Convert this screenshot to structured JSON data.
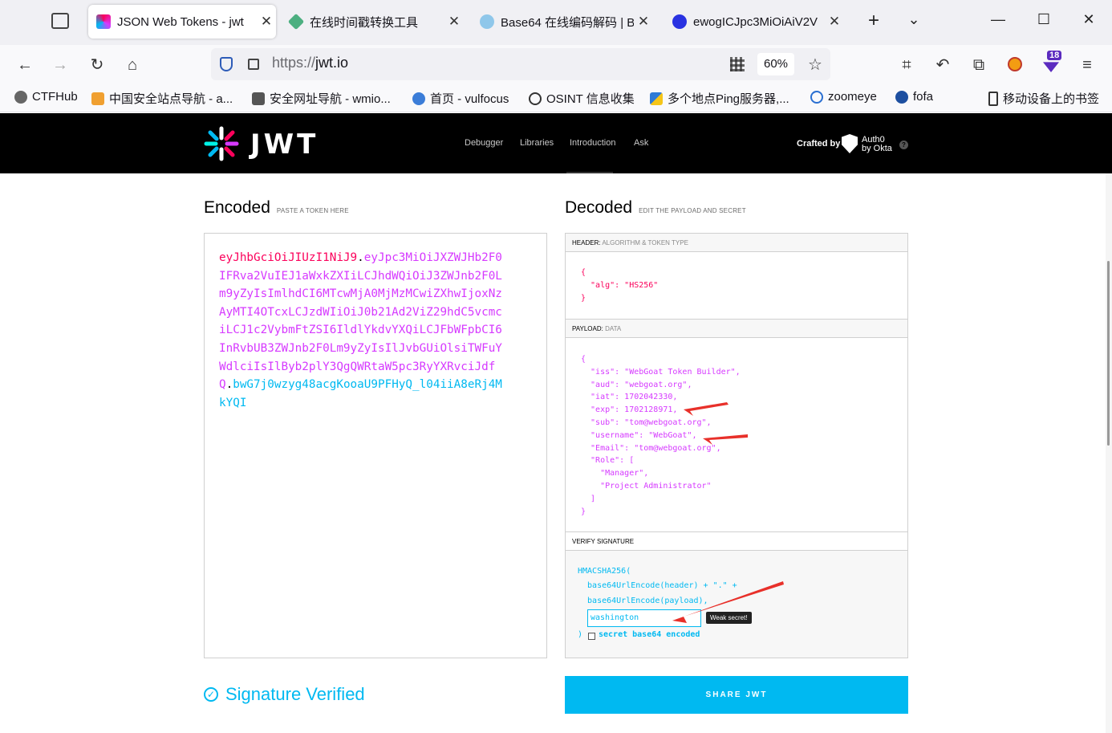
{
  "browser": {
    "tabs": [
      {
        "title": "JSON Web Tokens - jwt",
        "icon": "jwt-icon",
        "active": true
      },
      {
        "title": "在线时间戳转换工具",
        "icon": "timestamp-tool-icon",
        "active": false
      },
      {
        "title": "Base64 在线编码解码 | B",
        "icon": "base64-tool-icon",
        "active": false
      },
      {
        "title": "ewogICJpc3MiOiAiV2V",
        "icon": "baidu-paw-icon",
        "active": false
      }
    ],
    "url_protocol": "https://",
    "url_host": "jwt.io",
    "zoom": "60%",
    "extension_badge": "18",
    "bookmarks": [
      "CTFHub",
      "中国安全站点导航 - a...",
      "安全网址导航 - wmio...",
      "首页 - vulfocus",
      "OSINT 信息收集",
      "多个地点Ping服务器,...",
      "zoomeye",
      "fofa",
      "移动设备上的书签"
    ]
  },
  "site": {
    "logo_text": "JWT",
    "nav": [
      "Debugger",
      "Libraries",
      "Introduction",
      "Ask"
    ],
    "crafted_by": "Crafted by",
    "auth0_line1": "Auth0",
    "auth0_line2": "by Okta"
  },
  "encoded": {
    "title": "Encoded",
    "subtitle": "PASTE A TOKEN HERE",
    "header_part": "eyJhbGciOiJIUzI1NiJ9",
    "payload_part": "eyJpc3MiOiJXZWJHb2F0IFRva2VuIEJ1aWxkZXIiLCJhdWQiOiJ3ZWJnb2F0Lm9yZyIsImlhdCI6MTcwMjA0MjMzMCwiZXhwIjoxNzAyMTI4OTcxLCJzdWIiOiJ0b21Ad2ViZ29hdC5vcmciLCJ1c2VybmFtZSI6IldlYkdvYXQiLCJFbWFpbCI6InRvbUB3ZWJnb2F0Lm9yZyIsIlJvbGUiOlsiTWFuYWdlciIsIlByb2plY3QgQWRtaW5pc3RyYXRvciJdfQ",
    "signature_part": "bwG7j0wzyg48acgKooaU9PFHyQ_l04iiA8eRj4MkYQI",
    "dot": "."
  },
  "decoded": {
    "title": "Decoded",
    "subtitle": "EDIT THE PAYLOAD AND SECRET",
    "header_label": "HEADER:",
    "header_sub": "ALGORITHM & TOKEN TYPE",
    "header_json": "{\n  \"alg\": \"HS256\"\n}",
    "payload_label": "PAYLOAD:",
    "payload_sub": "DATA",
    "payload_json": "{\n  \"iss\": \"WebGoat Token Builder\",\n  \"aud\": \"webgoat.org\",\n  \"iat\": 1702042330,\n  \"exp\": 1702128971,\n  \"sub\": \"tom@webgoat.org\",\n  \"username\": \"WebGoat\",\n  \"Email\": \"tom@webgoat.org\",\n  \"Role\": [\n    \"Manager\",\n    \"Project Administrator\"\n  ]\n}",
    "verify_label": "VERIFY SIGNATURE",
    "sig_line1": "HMACSHA256(",
    "sig_line2": "  base64UrlEncode(header) + \".\" +",
    "sig_line3": "  base64UrlEncode(payload),",
    "secret_value": "washington",
    "weak_badge": "Weak secret!",
    "close_paren": ")",
    "b64_checkbox_label": "secret base64 encoded"
  },
  "status": {
    "verified_text": "Signature Verified"
  },
  "share_button": "SHARE JWT",
  "colors": {
    "header": "#fb015b",
    "payload": "#d63aff",
    "signature": "#00b9f1",
    "annotation_arrow": "#e8302a"
  }
}
